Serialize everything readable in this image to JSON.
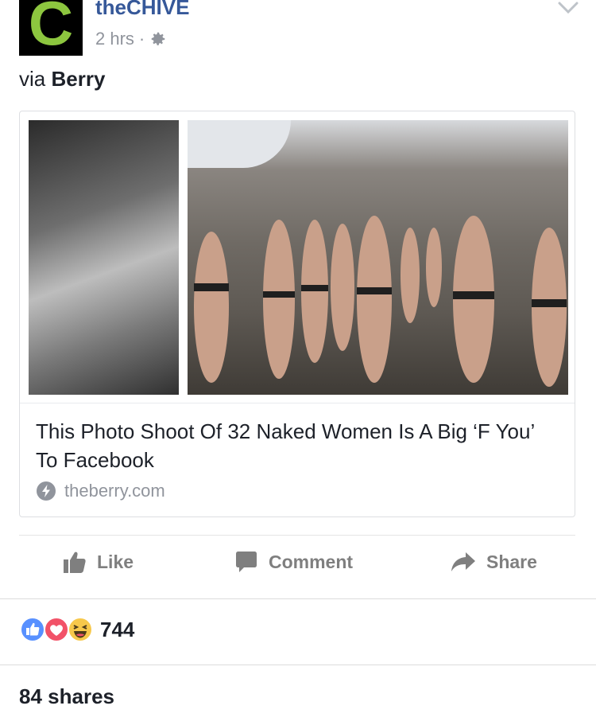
{
  "post": {
    "avatar_letter": "C",
    "page_name": "theCHIVE",
    "timestamp": "2 hrs",
    "dot": "·",
    "via_prefix": "via",
    "via_name": "Berry"
  },
  "link_card": {
    "title": "This Photo Shoot Of 32 Naked Women Is A Big ‘F You’ To Facebook",
    "source": "theberry.com",
    "images": [
      "black-and-white portrait photo",
      "group of women outdoors photo"
    ]
  },
  "actions": {
    "like_label": "Like",
    "comment_label": "Comment",
    "share_label": "Share"
  },
  "stats": {
    "reactions_count": "744",
    "reaction_icons": [
      "like-reaction-icon",
      "love-reaction-icon",
      "haha-reaction-icon"
    ],
    "shares_text": "84 shares"
  },
  "colors": {
    "brand_green": "#8dc63f",
    "link_blue": "#365899",
    "meta_gray": "#90949c",
    "like_blue": "#5890ff",
    "love_red": "#f25268",
    "haha_yellow": "#f7c84b"
  }
}
